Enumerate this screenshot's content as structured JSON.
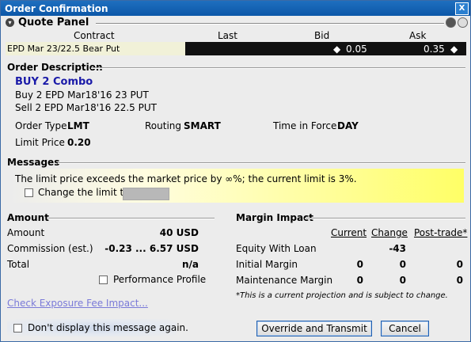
{
  "window": {
    "title": "Order Confirmation",
    "close_glyph": "X"
  },
  "quote_panel": {
    "title": "Quote Panel",
    "columns": {
      "contract": "Contract",
      "last": "Last",
      "bid": "Bid",
      "ask": "Ask"
    },
    "row": {
      "exchange": "EPD",
      "description": "Mar 23/22.5 Bear Put",
      "bid": "0.05",
      "ask": "0.35"
    }
  },
  "order_description": {
    "title": "Order Description",
    "combo": "BUY 2 Combo",
    "leg1": "Buy 2 EPD Mar18'16 23 PUT",
    "leg2": "Sell 2 EPD Mar18'16 22.5 PUT",
    "order_type_label": "Order Type",
    "order_type_value": "LMT",
    "routing_label": "Routing",
    "routing_value": "SMART",
    "tif_label": "Time in Force",
    "tif_value": "DAY",
    "limit_price_label": "Limit Price",
    "limit_price_value": "0.20"
  },
  "messages": {
    "title": "Messages",
    "text": "The limit price exceeds the market price by ∞%; the current limit is 3%.",
    "change_limit_label": "Change the limit to",
    "change_limit_value": ""
  },
  "amount": {
    "title": "Amount",
    "amount_label": "Amount",
    "amount_value": "40 USD",
    "commission_label": "Commission (est.)",
    "commission_value": "-0.23 ... 6.57 USD",
    "total_label": "Total",
    "total_value": "n/a",
    "performance_profile": "Performance Profile"
  },
  "margin": {
    "title": "Margin Impact",
    "col_current": "Current",
    "col_change": "Change",
    "col_post": "Post-trade*",
    "equity_label": "Equity With Loan",
    "equity_change": "-43",
    "initial_label": "Initial Margin",
    "initial_current": "0",
    "initial_change": "0",
    "initial_post": "0",
    "maint_label": "Maintenance Margin",
    "maint_current": "0",
    "maint_change": "0",
    "maint_post": "0",
    "note": "*This is a current projection and is subject to change."
  },
  "footer": {
    "exposure_link": "Check Exposure Fee Impact...",
    "dont_display": "Don't display this message again.",
    "override_button": "Override and Transmit",
    "cancel_button": "Cancel"
  }
}
